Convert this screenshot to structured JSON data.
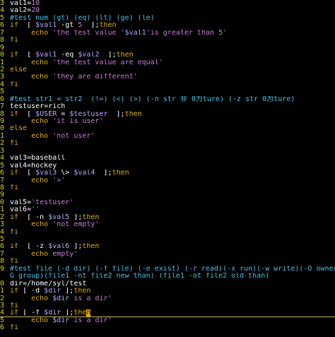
{
  "colors": {
    "background": "#000000",
    "line_number": "#d7d200",
    "keyword": "#e3b100",
    "string": "#c77bd6",
    "comment": "#46c3e8",
    "shell_var": "#b8a8ff",
    "plain": "#ffffff",
    "cursor": "#e3b100"
  },
  "lines": [
    {
      "ln": "3",
      "segs": [
        [
          "var",
          "val1"
        ],
        [
          "op",
          "="
        ],
        [
          "num",
          "10"
        ]
      ]
    },
    {
      "ln": "4",
      "segs": [
        [
          "var",
          "val2"
        ],
        [
          "op",
          "="
        ],
        [
          "num",
          "20"
        ]
      ]
    },
    {
      "ln": "5",
      "segs": [
        [
          "com",
          "#test num (gt) (eq) (lt) (ge) (le)"
        ]
      ]
    },
    {
      "ln": "6",
      "segs": [
        [
          "kw",
          "if"
        ],
        [
          "op",
          "  [ "
        ],
        [
          "dvar",
          "$val1"
        ],
        [
          "op",
          " -gt "
        ],
        [
          "num",
          "5"
        ],
        [
          "op",
          "  ];"
        ],
        [
          "kw",
          "then"
        ]
      ]
    },
    {
      "ln": "7",
      "segs": [
        [
          "op",
          "     "
        ],
        [
          "kw",
          "echo"
        ],
        [
          "str",
          " 'the test value '"
        ],
        [
          "dvar",
          "$val1"
        ],
        [
          "str",
          "'is greater than 5'"
        ]
      ]
    },
    {
      "ln": "8",
      "segs": [
        [
          "kw",
          "fi"
        ]
      ]
    },
    {
      "ln": "9",
      "segs": []
    },
    {
      "ln": "0",
      "segs": [
        [
          "kw",
          "if"
        ],
        [
          "op",
          "  [ "
        ],
        [
          "dvar",
          "$val1"
        ],
        [
          "op",
          " -eq "
        ],
        [
          "dvar",
          "$val2"
        ],
        [
          "op",
          "  ];"
        ],
        [
          "kw",
          "then"
        ]
      ]
    },
    {
      "ln": "1",
      "segs": [
        [
          "op",
          "     "
        ],
        [
          "kw",
          "echo"
        ],
        [
          "str",
          " 'the test value are equal'"
        ]
      ]
    },
    {
      "ln": "2",
      "segs": [
        [
          "kw",
          "else"
        ]
      ]
    },
    {
      "ln": "3",
      "segs": [
        [
          "op",
          "     "
        ],
        [
          "kw",
          "echo"
        ],
        [
          "str",
          " 'they are different'"
        ]
      ]
    },
    {
      "ln": "4",
      "segs": [
        [
          "kw",
          "fi"
        ]
      ]
    },
    {
      "ln": "5",
      "segs": []
    },
    {
      "ln": "6",
      "segs": [
        [
          "com",
          "#test str1 = str2  (!=) (<) (>) (-n str 非 0为ture) (-z str 0为ture)"
        ]
      ]
    },
    {
      "ln": "7",
      "segs": [
        [
          "var",
          "testuser"
        ],
        [
          "op",
          "="
        ],
        [
          "var",
          "rich"
        ]
      ]
    },
    {
      "ln": "8",
      "segs": [
        [
          "kw",
          "if"
        ],
        [
          "op",
          "  [ "
        ],
        [
          "dvar",
          "$USER"
        ],
        [
          "op",
          " = "
        ],
        [
          "dvar",
          "$testuser"
        ],
        [
          "op",
          "  ];"
        ],
        [
          "kw",
          "then"
        ]
      ]
    },
    {
      "ln": "9",
      "segs": [
        [
          "op",
          "     "
        ],
        [
          "kw",
          "echo"
        ],
        [
          "str",
          " 'it is user'"
        ]
      ]
    },
    {
      "ln": "0",
      "segs": [
        [
          "kw",
          "else"
        ]
      ]
    },
    {
      "ln": "1",
      "segs": [
        [
          "op",
          "     "
        ],
        [
          "kw",
          "echo"
        ],
        [
          "str",
          " 'not user'"
        ]
      ]
    },
    {
      "ln": "2",
      "segs": [
        [
          "kw",
          "fi"
        ]
      ]
    },
    {
      "ln": "3",
      "segs": []
    },
    {
      "ln": "4",
      "segs": [
        [
          "var",
          "val3"
        ],
        [
          "op",
          "="
        ],
        [
          "var",
          "baseball"
        ]
      ]
    },
    {
      "ln": "5",
      "segs": [
        [
          "var",
          "val4"
        ],
        [
          "op",
          "="
        ],
        [
          "var",
          "hockey"
        ]
      ]
    },
    {
      "ln": "6",
      "segs": [
        [
          "kw",
          "if"
        ],
        [
          "op",
          "  [ "
        ],
        [
          "dvar",
          "$val3"
        ],
        [
          "op",
          " \\> "
        ],
        [
          "dvar",
          "$val4"
        ],
        [
          "op",
          "  ];"
        ],
        [
          "kw",
          "then"
        ]
      ]
    },
    {
      "ln": "7",
      "segs": [
        [
          "op",
          "     "
        ],
        [
          "kw",
          "echo"
        ],
        [
          "str",
          " '>'"
        ]
      ]
    },
    {
      "ln": "8",
      "segs": [
        [
          "kw",
          "fi"
        ]
      ]
    },
    {
      "ln": "9",
      "segs": []
    },
    {
      "ln": "0",
      "segs": [
        [
          "var",
          "val5"
        ],
        [
          "op",
          "="
        ],
        [
          "str",
          "'testuser'"
        ]
      ]
    },
    {
      "ln": "1",
      "segs": [
        [
          "var",
          "val6"
        ],
        [
          "op",
          "="
        ],
        [
          "str",
          "''"
        ]
      ]
    },
    {
      "ln": "2",
      "segs": [
        [
          "kw",
          "if"
        ],
        [
          "op",
          "  [ -n "
        ],
        [
          "dvar",
          "$val5"
        ],
        [
          "op",
          " ];"
        ],
        [
          "kw",
          "then"
        ]
      ]
    },
    {
      "ln": "3",
      "segs": [
        [
          "op",
          "     "
        ],
        [
          "kw",
          "echo"
        ],
        [
          "str",
          " 'not empty'"
        ]
      ]
    },
    {
      "ln": "4",
      "segs": [
        [
          "kw",
          "fi"
        ]
      ]
    },
    {
      "ln": "5",
      "segs": []
    },
    {
      "ln": "6",
      "segs": [
        [
          "kw",
          "if"
        ],
        [
          "op",
          "  [ -z "
        ],
        [
          "dvar",
          "$val6"
        ],
        [
          "op",
          " ];"
        ],
        [
          "kw",
          "then"
        ]
      ]
    },
    {
      "ln": "7",
      "segs": [
        [
          "op",
          "     "
        ],
        [
          "kw",
          "echo"
        ],
        [
          "str",
          " empty'"
        ]
      ]
    },
    {
      "ln": "8",
      "segs": [
        [
          "kw",
          "fi"
        ]
      ]
    },
    {
      "ln": "9",
      "segs": [
        [
          "com",
          "#test file (-d dir) (-f file) (-e exist) (-r read)(-x run)(-w write)(-O owner)(-"
        ]
      ]
    },
    {
      "ln": "",
      "segs": [
        [
          "com",
          "G group)(file1 -nt file2 new than) (file1 -ot file2 old than)"
        ]
      ]
    },
    {
      "ln": "0",
      "segs": [
        [
          "var",
          "dir"
        ],
        [
          "op",
          "="
        ],
        [
          "var",
          "/home/syl/test"
        ]
      ]
    },
    {
      "ln": "1",
      "segs": [
        [
          "kw",
          "if"
        ],
        [
          "op",
          " [ -d "
        ],
        [
          "dvar",
          "$dir"
        ],
        [
          "op",
          " ];"
        ],
        [
          "kw",
          "then"
        ]
      ]
    },
    {
      "ln": "2",
      "segs": [
        [
          "op",
          "     "
        ],
        [
          "kw",
          "echo"
        ],
        [
          "op",
          " "
        ],
        [
          "dvar",
          "$dir"
        ],
        [
          "str",
          " is a dir'"
        ]
      ]
    },
    {
      "ln": "3",
      "segs": [
        [
          "kw",
          "fi"
        ]
      ]
    },
    {
      "ln": "4",
      "cursorline": true,
      "segs": [
        [
          "kw",
          "if"
        ],
        [
          "op",
          " [ -f "
        ],
        [
          "dvar",
          "$dir"
        ],
        [
          "op",
          " ];"
        ],
        [
          "kw",
          "the"
        ],
        [
          "cursor",
          "n"
        ]
      ]
    },
    {
      "ln": "5",
      "segs": [
        [
          "op",
          "     "
        ],
        [
          "kw",
          "echo"
        ],
        [
          "op",
          " "
        ],
        [
          "dvar",
          "$dir"
        ],
        [
          "str",
          " is a dir'"
        ]
      ]
    },
    {
      "ln": "6",
      "segs": [
        [
          "kw",
          "fi"
        ]
      ]
    }
  ]
}
